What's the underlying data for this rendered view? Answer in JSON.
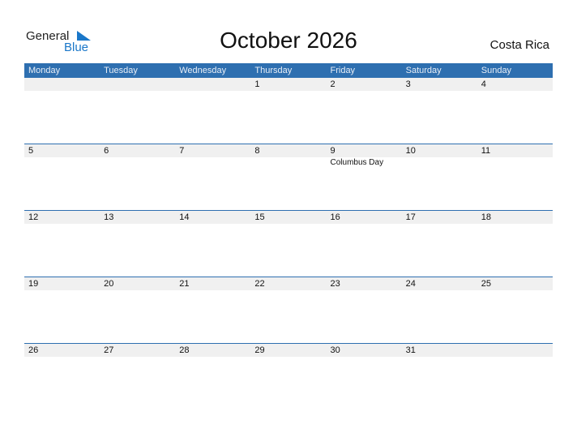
{
  "logo": {
    "line1": "General",
    "line2": "Blue"
  },
  "title": "October 2026",
  "country": "Costa Rica",
  "weekdays": [
    "Monday",
    "Tuesday",
    "Wednesday",
    "Thursday",
    "Friday",
    "Saturday",
    "Sunday"
  ],
  "weeks": [
    {
      "days": [
        "",
        "",
        "",
        "1",
        "2",
        "3",
        "4"
      ],
      "holidays": [
        "",
        "",
        "",
        "",
        "",
        "",
        ""
      ]
    },
    {
      "days": [
        "5",
        "6",
        "7",
        "8",
        "9",
        "10",
        "11"
      ],
      "holidays": [
        "",
        "",
        "",
        "",
        "Columbus Day",
        "",
        ""
      ]
    },
    {
      "days": [
        "12",
        "13",
        "14",
        "15",
        "16",
        "17",
        "18"
      ],
      "holidays": [
        "",
        "",
        "",
        "",
        "",
        "",
        ""
      ]
    },
    {
      "days": [
        "19",
        "20",
        "21",
        "22",
        "23",
        "24",
        "25"
      ],
      "holidays": [
        "",
        "",
        "",
        "",
        "",
        "",
        ""
      ]
    },
    {
      "days": [
        "26",
        "27",
        "28",
        "29",
        "30",
        "31",
        ""
      ],
      "holidays": [
        "",
        "",
        "",
        "",
        "",
        "",
        ""
      ]
    }
  ]
}
